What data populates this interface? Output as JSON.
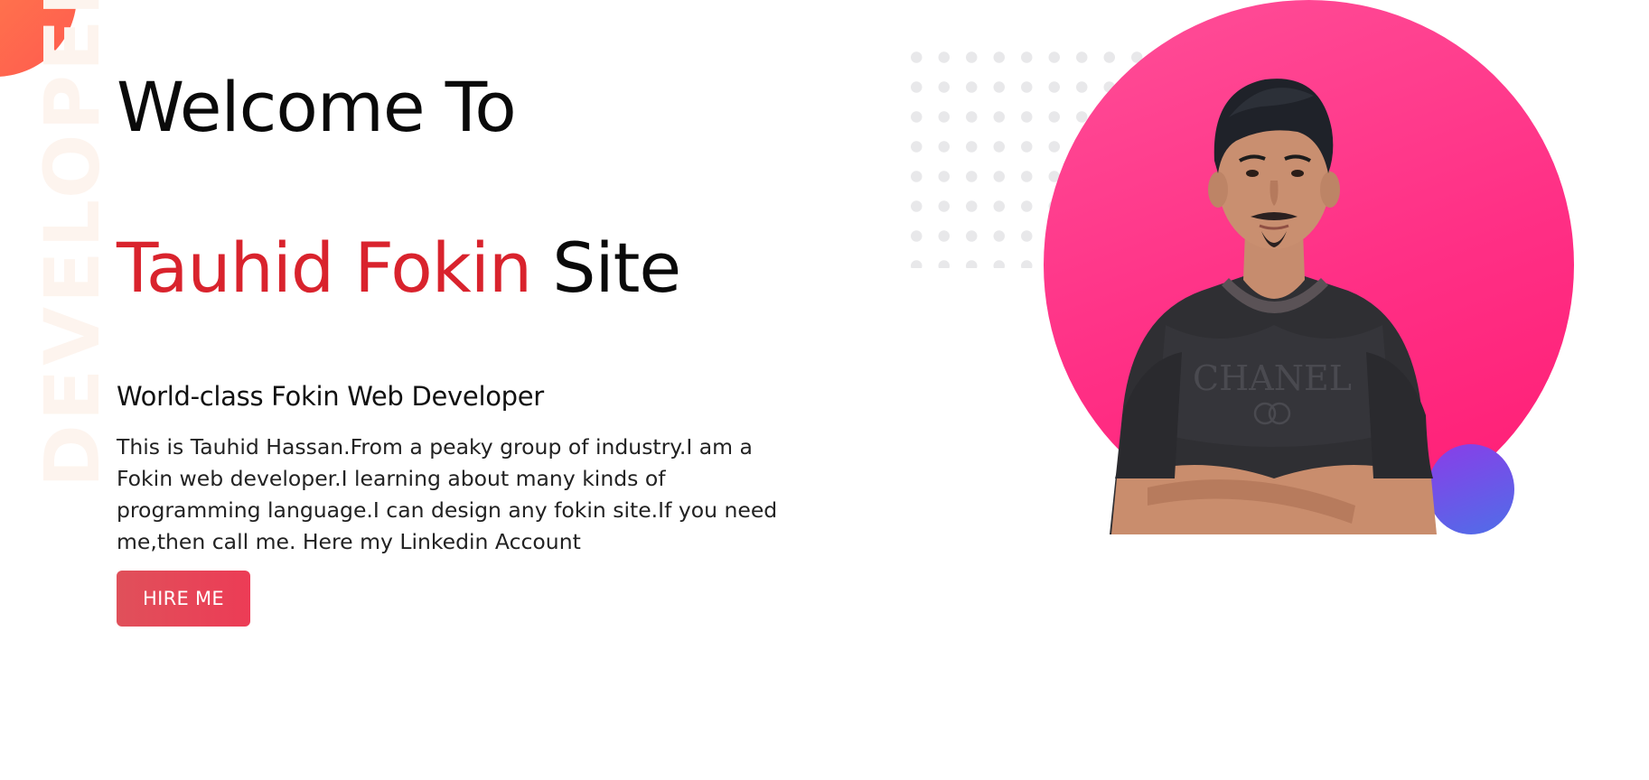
{
  "hero": {
    "welcome": "Welcome To",
    "name_accent": "Tauhid Fokin",
    "name_suffix": " Site",
    "tagline": "World-class Fokin Web Developer",
    "intro": "This is Tauhid Hassan.From a peaky group of industry.I am a Fokin web developer.I learning about many kinds of programming language.I can design any fokin site.If you need me,then call me. Here my Linkedin Account",
    "button_label": "HIRE ME"
  },
  "decor": {
    "watermark": "DEVELOPER",
    "shirt_brand": "CHANEL"
  },
  "colors": {
    "accent_red": "#d9232d",
    "button": "#e6475a",
    "circle_pink": "#ff2f85",
    "accent_purple": "#6a55e8"
  }
}
